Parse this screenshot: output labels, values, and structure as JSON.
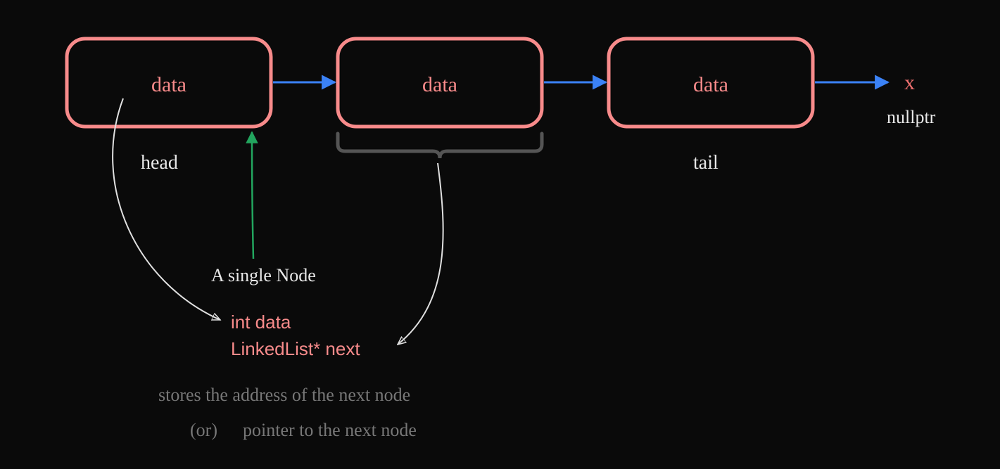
{
  "colors": {
    "bg": "#0a0a0a",
    "node_border": "#f88b8b",
    "node_text": "#f88b8b",
    "arrow_blue": "#3b82f6",
    "arrow_green": "#22a55e",
    "arrow_white": "#e0e0e0",
    "label_white": "#e8e8e8",
    "label_gray": "#777777",
    "nullptr_x": "#f07070",
    "code_text": "#f88b8b",
    "bracket_gray": "#555555"
  },
  "nodes": [
    {
      "label": "data"
    },
    {
      "label": "data"
    },
    {
      "label": "data"
    }
  ],
  "labels": {
    "head": "head",
    "tail": "tail",
    "nullptr": "nullptr",
    "nullptr_x": "x",
    "single_node": "A single Node",
    "code_line1": "int data",
    "code_line2": "LinkedList* next",
    "desc_line1": "stores the address of the next node",
    "desc_or": "(or)",
    "desc_line2": "pointer to the next node"
  }
}
